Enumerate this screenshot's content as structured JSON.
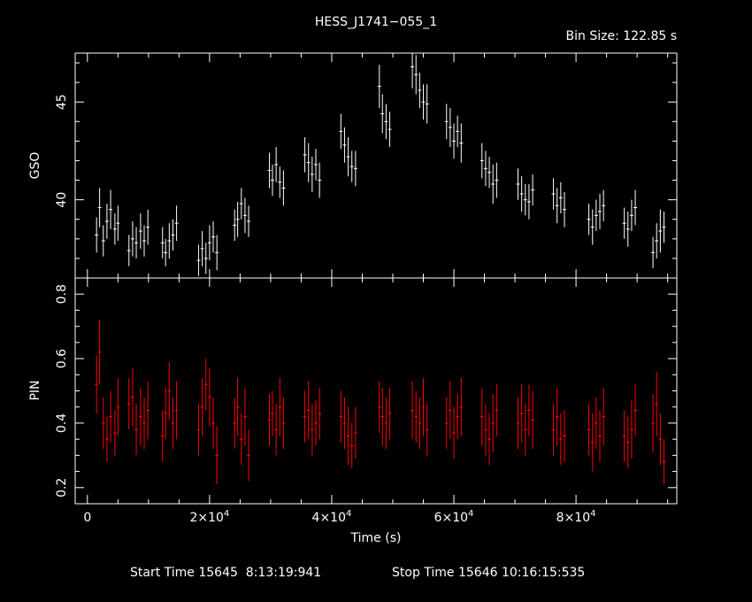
{
  "chart_data": [
    {
      "type": "scatter",
      "title": "HESS_J1741−055_1",
      "annotation": "Bin Size: 122.85 s",
      "xlabel": "Time (s)",
      "ylabel": "GSO",
      "xlim": [
        -2000,
        96500
      ],
      "ylim": [
        36.0,
        47.5
      ],
      "ytick_labels": [
        "40",
        "45"
      ],
      "error_bars": true,
      "color": "#ffffff",
      "series": [
        {
          "segments": [
            {
              "t": [
                1500,
                2000,
                2600,
                3200,
                3800,
                4500,
                5000
              ],
              "y": [
                38.2,
                39.6,
                37.9,
                38.9,
                39.5,
                38.5,
                38.8
              ],
              "err": [
                0.9,
                1.0,
                0.8,
                0.9,
                1.0,
                0.8,
                0.9
              ]
            },
            {
              "t": [
                6800,
                7400,
                8000,
                8700,
                9300,
                9900
              ],
              "y": [
                37.4,
                38.0,
                37.8,
                38.4,
                37.9,
                38.6
              ],
              "err": [
                0.8,
                0.9,
                0.8,
                0.9,
                0.8,
                0.9
              ]
            },
            {
              "t": [
                12300,
                12800,
                13400,
                14000,
                14600
              ],
              "y": [
                37.8,
                37.3,
                37.9,
                38.2,
                38.8
              ],
              "err": [
                0.8,
                0.7,
                0.9,
                0.8,
                0.9
              ]
            },
            {
              "t": [
                18200,
                18800,
                19400,
                20000,
                20600,
                21200
              ],
              "y": [
                36.9,
                37.5,
                37.0,
                37.8,
                38.1,
                37.3
              ],
              "err": [
                0.8,
                0.9,
                0.8,
                0.9,
                0.8,
                0.9
              ]
            },
            {
              "t": [
                24100,
                24600,
                25200,
                25800,
                26400
              ],
              "y": [
                38.7,
                39.0,
                39.8,
                39.2,
                38.9
              ],
              "err": [
                0.8,
                0.9,
                0.8,
                0.9,
                0.8
              ]
            },
            {
              "t": [
                29800,
                30300,
                30900,
                31500,
                32100
              ],
              "y": [
                41.5,
                41.0,
                41.8,
                40.9,
                40.6
              ],
              "err": [
                0.9,
                0.8,
                0.9,
                0.8,
                0.9
              ]
            },
            {
              "t": [
                35600,
                36200,
                36800,
                37400,
                38000
              ],
              "y": [
                42.3,
                41.9,
                41.3,
                41.8,
                41.0
              ],
              "err": [
                0.9,
                1.0,
                0.9,
                0.8,
                0.9
              ]
            },
            {
              "t": [
                41500,
                42100,
                42700,
                43300,
                43900
              ],
              "y": [
                43.5,
                42.8,
                42.2,
                41.7,
                41.6
              ],
              "err": [
                0.9,
                0.9,
                1.0,
                0.8,
                0.9
              ]
            },
            {
              "t": [
                47800,
                48300,
                48900,
                49500
              ],
              "y": [
                45.8,
                44.4,
                44.0,
                43.6
              ],
              "err": [
                1.1,
                1.0,
                0.9,
                0.9
              ]
            },
            {
              "t": [
                53200,
                53800,
                54400,
                55000,
                55600
              ],
              "y": [
                46.8,
                46.4,
                45.6,
                45.0,
                44.9
              ],
              "err": [
                1.1,
                1.0,
                0.9,
                0.9,
                1.0
              ]
            },
            {
              "t": [
                58800,
                59400,
                60000,
                60600,
                61200
              ],
              "y": [
                44.0,
                43.7,
                43.0,
                43.5,
                42.9
              ],
              "err": [
                0.9,
                1.0,
                0.9,
                0.8,
                1.0
              ]
            },
            {
              "t": [
                64600,
                65200,
                65800,
                66400,
                67000
              ],
              "y": [
                42.0,
                41.6,
                41.4,
                40.8,
                41.0
              ],
              "err": [
                0.9,
                0.9,
                0.8,
                1.0,
                0.9
              ]
            },
            {
              "t": [
                70500,
                71100,
                71700,
                72300,
                72900
              ],
              "y": [
                40.8,
                40.3,
                40.0,
                39.9,
                40.5
              ],
              "err": [
                0.8,
                0.9,
                0.8,
                0.9,
                0.8
              ]
            },
            {
              "t": [
                76300,
                76900,
                77500,
                78100
              ],
              "y": [
                40.3,
                39.7,
                40.1,
                39.5
              ],
              "err": [
                0.8,
                0.9,
                0.8,
                0.9
              ]
            },
            {
              "t": [
                82100,
                82700,
                83300,
                83900,
                84500
              ],
              "y": [
                39.0,
                38.6,
                39.2,
                39.4,
                39.7
              ],
              "err": [
                0.8,
                0.9,
                0.8,
                0.9,
                0.8
              ]
            },
            {
              "t": [
                87900,
                88500,
                89100,
                89700
              ],
              "y": [
                38.8,
                38.5,
                39.2,
                39.6
              ],
              "err": [
                0.8,
                0.9,
                0.8,
                0.9
              ]
            },
            {
              "t": [
                92600,
                93200,
                93800,
                94400
              ],
              "y": [
                37.3,
                37.9,
                38.4,
                38.6
              ],
              "err": [
                0.8,
                0.9,
                1.1,
                0.8
              ]
            }
          ]
        }
      ]
    },
    {
      "type": "scatter",
      "xlabel": "Time (s)",
      "ylabel": "PIN",
      "xlim": [
        -2000,
        96500
      ],
      "ylim": [
        0.15,
        0.85
      ],
      "ytick_labels": [
        "0.2",
        "0.4",
        "0.6",
        "0.8"
      ],
      "xtick_labels": [
        "0",
        "2×10",
        "4×10",
        "6×10",
        "8×10"
      ],
      "xtick_exponent": "4",
      "error_bars": true,
      "color": "#ff0000",
      "series": [
        {
          "segments": [
            {
              "t": [
                1500,
                2000,
                2600,
                3200,
                3800,
                4500,
                5000
              ],
              "y": [
                0.52,
                0.62,
                0.4,
                0.35,
                0.42,
                0.37,
                0.45
              ],
              "err": [
                0.09,
                0.1,
                0.08,
                0.07,
                0.08,
                0.07,
                0.09
              ]
            },
            {
              "t": [
                6800,
                7400,
                8000,
                8700,
                9300,
                9900
              ],
              "y": [
                0.46,
                0.48,
                0.38,
                0.42,
                0.4,
                0.44
              ],
              "err": [
                0.08,
                0.09,
                0.08,
                0.09,
                0.08,
                0.09
              ]
            },
            {
              "t": [
                12300,
                12800,
                13400,
                14000,
                14600
              ],
              "y": [
                0.36,
                0.43,
                0.5,
                0.4,
                0.44
              ],
              "err": [
                0.08,
                0.08,
                0.09,
                0.08,
                0.09
              ]
            },
            {
              "t": [
                18200,
                18800,
                19400,
                20000,
                20600,
                21200
              ],
              "y": [
                0.38,
                0.45,
                0.52,
                0.48,
                0.4,
                0.3
              ],
              "err": [
                0.08,
                0.09,
                0.08,
                0.09,
                0.08,
                0.09
              ]
            },
            {
              "t": [
                24100,
                24600,
                25200,
                25800,
                26400
              ],
              "y": [
                0.4,
                0.45,
                0.35,
                0.42,
                0.3
              ],
              "err": [
                0.08,
                0.09,
                0.08,
                0.09,
                0.08
              ]
            },
            {
              "t": [
                29800,
                30300,
                30900,
                31500,
                32100
              ],
              "y": [
                0.41,
                0.43,
                0.38,
                0.45,
                0.4
              ],
              "err": [
                0.08,
                0.07,
                0.08,
                0.09,
                0.08
              ]
            },
            {
              "t": [
                35600,
                36200,
                36800,
                37400,
                38000
              ],
              "y": [
                0.42,
                0.44,
                0.38,
                0.4,
                0.43
              ],
              "err": [
                0.08,
                0.09,
                0.08,
                0.07,
                0.08
              ]
            },
            {
              "t": [
                41500,
                42100,
                42700,
                43300,
                43900
              ],
              "y": [
                0.42,
                0.4,
                0.36,
                0.33,
                0.37
              ],
              "err": [
                0.08,
                0.08,
                0.09,
                0.07,
                0.08
              ]
            },
            {
              "t": [
                47800,
                48300,
                48900,
                49500
              ],
              "y": [
                0.45,
                0.42,
                0.4,
                0.43
              ],
              "err": [
                0.08,
                0.09,
                0.08,
                0.08
              ]
            },
            {
              "t": [
                53200,
                53800,
                54400,
                55000,
                55600
              ],
              "y": [
                0.44,
                0.42,
                0.4,
                0.45,
                0.38
              ],
              "err": [
                0.09,
                0.08,
                0.08,
                0.09,
                0.08
              ]
            },
            {
              "t": [
                58800,
                59400,
                60000,
                60600,
                61200
              ],
              "y": [
                0.4,
                0.44,
                0.37,
                0.42,
                0.45
              ],
              "err": [
                0.08,
                0.09,
                0.08,
                0.07,
                0.09
              ]
            },
            {
              "t": [
                64600,
                65200,
                65800,
                66400,
                67000
              ],
              "y": [
                0.42,
                0.38,
                0.35,
                0.4,
                0.44
              ],
              "err": [
                0.09,
                0.08,
                0.08,
                0.09,
                0.08
              ]
            },
            {
              "t": [
                70500,
                71100,
                71700,
                72300,
                72900
              ],
              "y": [
                0.4,
                0.43,
                0.38,
                0.44,
                0.41
              ],
              "err": [
                0.08,
                0.09,
                0.08,
                0.08,
                0.09
              ]
            },
            {
              "t": [
                76300,
                76900,
                77500,
                78100
              ],
              "y": [
                0.38,
                0.42,
                0.35,
                0.36
              ],
              "err": [
                0.08,
                0.09,
                0.08,
                0.08
              ]
            },
            {
              "t": [
                82100,
                82700,
                83300,
                83900,
                84500
              ],
              "y": [
                0.38,
                0.34,
                0.4,
                0.36,
                0.42
              ],
              "err": [
                0.08,
                0.09,
                0.08,
                0.08,
                0.09
              ]
            },
            {
              "t": [
                87900,
                88500,
                89100,
                89700
              ],
              "y": [
                0.36,
                0.34,
                0.38,
                0.44
              ],
              "err": [
                0.08,
                0.08,
                0.09,
                0.08
              ]
            },
            {
              "t": [
                92600,
                93200,
                93800,
                94400
              ],
              "y": [
                0.4,
                0.46,
                0.35,
                0.28
              ],
              "err": [
                0.09,
                0.1,
                0.08,
                0.07
              ]
            }
          ]
        }
      ]
    }
  ],
  "footer": {
    "start_label": "Start Time 15645  8:13:19:941",
    "stop_label": "Stop Time 15646 10:16:15:535"
  }
}
